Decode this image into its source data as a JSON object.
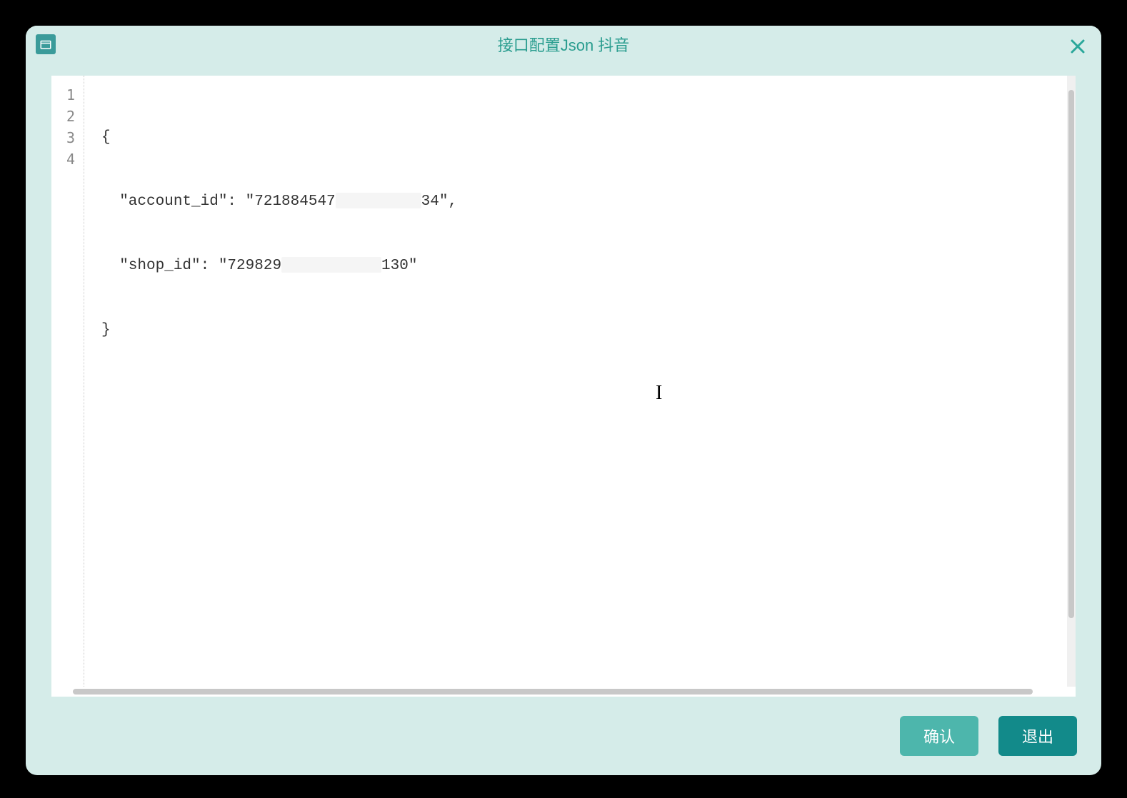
{
  "titlebar": {
    "title": "接口配置Json 抖音"
  },
  "editor": {
    "line_numbers": [
      "1",
      "2",
      "3",
      "4"
    ],
    "code": {
      "line1": "{",
      "line2_pre": "  \"account_id\": \"721884547",
      "line2_post": "34\",",
      "line3_pre": "  \"shop_id\": \"729829",
      "line3_post": "130\"",
      "line4": "}"
    }
  },
  "buttons": {
    "confirm": "确认",
    "exit": "退出"
  }
}
